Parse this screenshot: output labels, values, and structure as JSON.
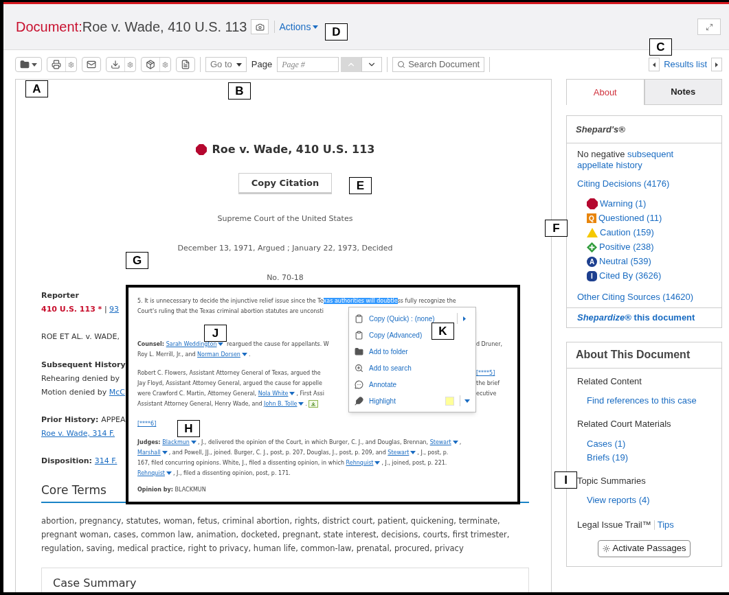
{
  "header": {
    "label": "Document:",
    "title": "Roe v. Wade, 410 U.S. 113",
    "actions": "Actions"
  },
  "toolbar": {
    "goto": "Go to",
    "page_label": "Page",
    "page_placeholder": "Page #",
    "search": "Search Document",
    "results": "Results list"
  },
  "document": {
    "title": "Roe v. Wade, 410 U.S. 113",
    "copy_citation": "Copy Citation",
    "court": "Supreme Court of the United States",
    "dates": "December 13, 1971, Argued ; January 22, 1973, Decided",
    "number": "No. 70-18",
    "left_lines": [
      {
        "kind": "heading",
        "segments": [
          {
            "kind": "plain",
            "text": "Reporter"
          }
        ]
      },
      {
        "kind": "line",
        "segments": [
          {
            "kind": "cite",
            "text": "410 U.S. 113 *"
          },
          {
            "kind": "plain",
            "text": " | "
          },
          {
            "kind": "link",
            "text": "93"
          }
        ]
      },
      {
        "kind": "gap"
      },
      {
        "kind": "line",
        "segments": [
          {
            "kind": "plain",
            "text": "ROE ET AL. v. WADE,"
          }
        ]
      },
      {
        "kind": "gap"
      },
      {
        "kind": "heading",
        "segments": [
          {
            "kind": "plain",
            "text": "Subsequent History"
          }
        ]
      },
      {
        "kind": "line",
        "segments": [
          {
            "kind": "plain",
            "text": "Rehearing denied by"
          }
        ]
      },
      {
        "kind": "line",
        "segments": [
          {
            "kind": "plain",
            "text": "Motion denied by "
          },
          {
            "kind": "link",
            "text": "McC"
          }
        ]
      },
      {
        "kind": "gap"
      },
      {
        "kind": "line",
        "segments": [
          {
            "kind": "bold",
            "text": "Prior History: "
          },
          {
            "kind": "plain",
            "text": "APPEA"
          }
        ]
      },
      {
        "kind": "line",
        "segments": [
          {
            "kind": "link",
            "text": "Roe v. Wade, 314 F."
          }
        ]
      },
      {
        "kind": "gap"
      },
      {
        "kind": "line",
        "segments": [
          {
            "kind": "bold",
            "text": "Disposition: "
          },
          {
            "kind": "link",
            "text": "314 F."
          }
        ]
      }
    ],
    "core_terms": {
      "title": "Core Terms",
      "text": "abortion, pregnancy, statutes, woman, fetus, criminal abortion, rights, district court, patient, quickening, terminate, pregnant woman, cases, common law, animation, docketed, pregnant, state interest, decisions, courts, first trimester, regulation, saving, medical practice, right to privacy, human life, common-law, prenatal, procured, privacy"
    },
    "case_summary": "Case Summary"
  },
  "sidebar": {
    "tabs": [
      {
        "label": "About",
        "selected": true
      },
      {
        "label": "Notes",
        "selected": false
      }
    ],
    "shepards": {
      "title": "Shepard's®",
      "no_negative": "No negative ",
      "history_link": "subsequent appellate history",
      "citing": "Citing Decisions (4176)",
      "signals": [
        {
          "kind": "warning",
          "label": "Warning (1)"
        },
        {
          "kind": "questioned",
          "glyph": "Q",
          "label": "Questioned (11)"
        },
        {
          "kind": "caution",
          "label": "Caution (159)"
        },
        {
          "kind": "positive",
          "label": "Positive (238)"
        },
        {
          "kind": "neutral",
          "glyph": "A",
          "label": "Neutral (539)"
        },
        {
          "kind": "cited",
          "glyph": "I",
          "label": "Cited By (3626)"
        }
      ],
      "other": "Other Citing Sources (14620)",
      "shepardize": "*Shepardize®* this document"
    },
    "about": {
      "title": "About This Document",
      "groups": [
        {
          "label": "Related Content",
          "links": [
            "Find references to this case"
          ]
        },
        {
          "label": "Related Court Materials",
          "links": [
            "Cases (1)",
            "Briefs (19)"
          ]
        },
        {
          "label": "Topic Summaries",
          "links": [
            "View reports (4)"
          ]
        }
      ],
      "trail": "Legal Issue Trail™",
      "tips": "Tips",
      "activate": "Activate Passages"
    }
  },
  "inset": {
    "paragraphs": [
      {
        "lines": [
          {
            "left": [
              {
                "kind": "plain",
                "text": "5. It is unnecessary to decide the injunctive relief issue since the Te"
              },
              {
                "kind": "highlight",
                "text": "xas authorities will doubtle"
              },
              {
                "kind": "plain",
                "text": "ss fully recognize the"
              }
            ]
          },
          {
            "left": [
              {
                "kind": "plain",
                "text": "Court's ruling that the Texas criminal abortion statutes are unconsti"
              }
            ]
          }
        ]
      },
      {
        "lines": [
          {
            "left": [
              {
                "kind": "bold",
                "text": "Counsel: "
              },
              {
                "kind": "person",
                "text": "Sarah Weddington"
              },
              {
                "kind": "plain",
                "text": " reargued the cause for appellants. W"
              }
            ],
            "right": [
              {
                "kind": "plain",
                "text": "d Druner,"
              }
            ]
          },
          {
            "left": [
              {
                "kind": "plain",
                "text": "Roy L. Merrill, Jr., and "
              },
              {
                "kind": "person",
                "text": "Norman Dorsen"
              },
              {
                "kind": "plain",
                "text": "."
              }
            ]
          }
        ]
      },
      {
        "lines": [
          {
            "left": [
              {
                "kind": "plain",
                "text": "Robert C. Flowers, Assistant Attorney General of Texas, argued the"
              }
            ],
            "right": [
              {
                "kind": "link",
                "text": "[****5]"
              }
            ]
          },
          {
            "left": [
              {
                "kind": "plain",
                "text": "Jay Floyd, Assistant Attorney General, argued the cause for appelle"
              }
            ],
            "right": [
              {
                "kind": "plain",
                "text": "the brief"
              }
            ]
          },
          {
            "left": [
              {
                "kind": "plain",
                "text": "were Crawford C. Martin, Attorney General, "
              },
              {
                "kind": "person",
                "text": "Nola White"
              },
              {
                "kind": "plain",
                "text": ", First Assi"
              }
            ],
            "right": [
              {
                "kind": "plain",
                "text": "ecutive"
              }
            ]
          },
          {
            "left": [
              {
                "kind": "plain",
                "text": "Assistant Attorney General, Henry Wade, and "
              },
              {
                "kind": "person",
                "text": "John B. Tolle"
              },
              {
                "kind": "plain",
                "text": ". "
              },
              {
                "kind": "marker"
              }
            ]
          }
        ]
      },
      {
        "lines": [
          {
            "left": [
              {
                "kind": "link",
                "text": "[****6]"
              }
            ]
          }
        ]
      },
      {
        "lines": [
          {
            "left": [
              {
                "kind": "bold",
                "text": "Judges: "
              },
              {
                "kind": "person",
                "text": "Blackmun"
              },
              {
                "kind": "plain",
                "text": ", J., delivered the opinion of the Court, in which Burger, C. J., and Douglas, Brennan, "
              },
              {
                "kind": "person",
                "text": "Stewart"
              },
              {
                "kind": "plain",
                "text": ","
              }
            ]
          },
          {
            "left": [
              {
                "kind": "person",
                "text": "Marshall"
              },
              {
                "kind": "plain",
                "text": ", and Powell, JJ., joined. Burger, C. J., post, p. 207, Douglas, J., post, p. 209, and "
              },
              {
                "kind": "person",
                "text": "Stewart"
              },
              {
                "kind": "plain",
                "text": ", J., post, p."
              }
            ]
          },
          {
            "left": [
              {
                "kind": "plain",
                "text": "167, filed concurring opinions. White, J., filed a dissenting opinion, in which "
              },
              {
                "kind": "person",
                "text": "Rehnquist"
              },
              {
                "kind": "plain",
                "text": ", J., joined, post, p. 221."
              }
            ]
          },
          {
            "left": [
              {
                "kind": "person",
                "text": "Rehnquist"
              },
              {
                "kind": "plain",
                "text": ", J., filed a dissenting opinion, post, p. 171."
              }
            ]
          }
        ]
      },
      {
        "lines": [
          {
            "left": [
              {
                "kind": "bold",
                "text": "Opinion by: "
              },
              {
                "kind": "plain",
                "text": "BLACKMUN"
              }
            ]
          }
        ]
      }
    ],
    "menu": [
      {
        "kind": "copy_quick",
        "label": "Copy (Quick) : (none)"
      },
      {
        "kind": "copy",
        "label": "Copy (Advanced)"
      },
      {
        "kind": "folder",
        "label": "Add to folder"
      },
      {
        "kind": "search",
        "label": "Add to search"
      },
      {
        "kind": "annotate",
        "label": "Annotate"
      },
      {
        "kind": "highlight",
        "label": "Highlight",
        "color": "#ffff99"
      }
    ]
  },
  "callouts": [
    "A",
    "B",
    "C",
    "D",
    "E",
    "F",
    "G",
    "H",
    "I",
    "J",
    "K"
  ]
}
